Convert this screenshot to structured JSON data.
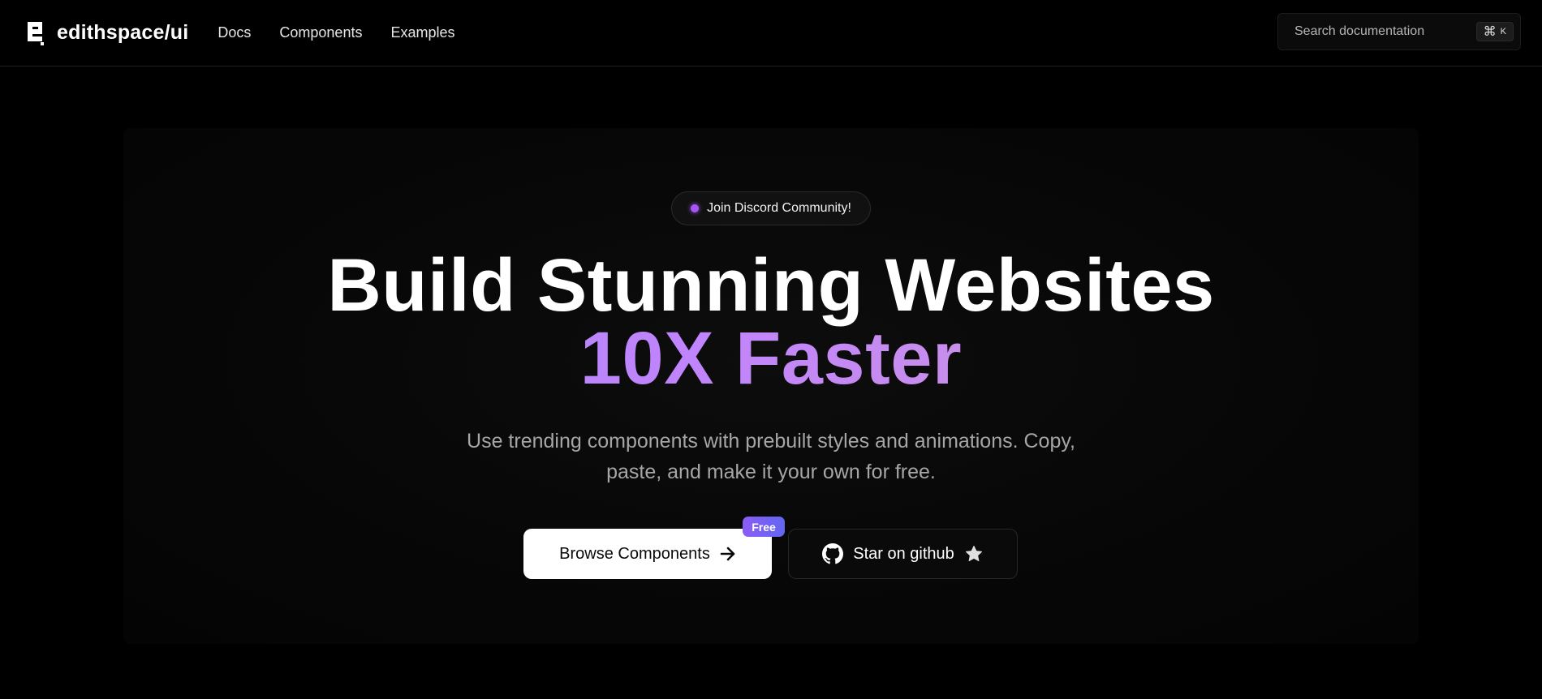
{
  "header": {
    "brand": "edithspace/ui",
    "brand_icon": "logo-e-icon",
    "nav": [
      {
        "label": "Docs"
      },
      {
        "label": "Components"
      },
      {
        "label": "Examples"
      }
    ],
    "search": {
      "placeholder": "Search documentation",
      "shortcut_symbol": "⌘",
      "shortcut_key": "K"
    }
  },
  "hero": {
    "badge": {
      "label": "Join Discord Community!",
      "dot_color": "#a855f7"
    },
    "headline_line1": "Build Stunning Websites",
    "headline_line2": "10X Faster",
    "headline_gradient": [
      "#a78bfa",
      "#c084fc",
      "#d8a4c8"
    ],
    "subtitle": "Use trending components with prebuilt styles and animations. Copy, paste, and make it your own for free.",
    "primary_button": {
      "label": "Browse Components",
      "icon": "arrow-right-icon",
      "tag": "Free"
    },
    "secondary_button": {
      "label": "Star on github",
      "icons": [
        "github-icon",
        "star-icon"
      ]
    }
  },
  "colors": {
    "background": "#000000",
    "accent": "#a855f7",
    "tag_gradient": [
      "#8b5cf6",
      "#6366f1"
    ]
  }
}
